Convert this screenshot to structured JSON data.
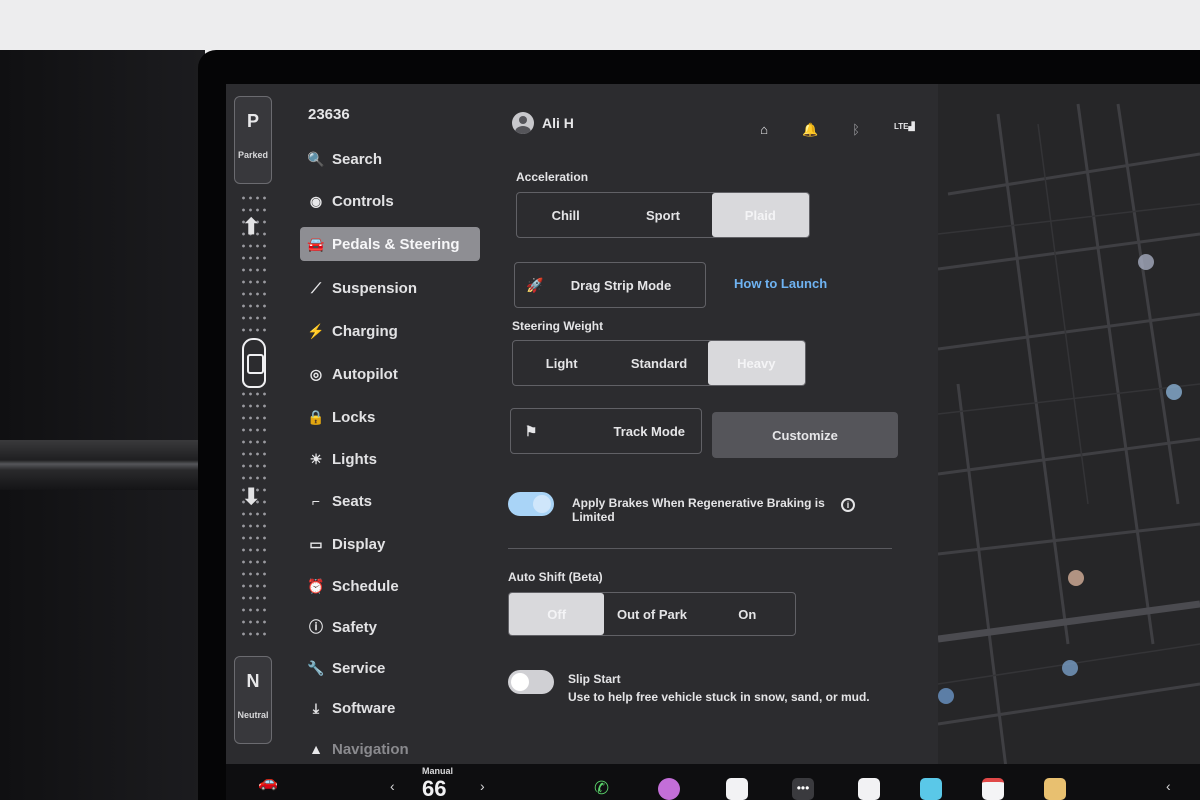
{
  "gear": {
    "top_letter": "P",
    "top_label": "Parked",
    "bottom_letter": "N",
    "bottom_label": "Neutral"
  },
  "odometer": "23636",
  "menu": [
    {
      "icon": "search-icon",
      "glyph": "🔍",
      "label": "Search",
      "active": false
    },
    {
      "icon": "controls-icon",
      "glyph": "◉",
      "label": "Controls",
      "active": false
    },
    {
      "icon": "car-icon",
      "glyph": "🚘",
      "label": "Pedals & Steering",
      "active": true
    },
    {
      "icon": "suspension-icon",
      "glyph": "⟋",
      "label": "Suspension",
      "active": false
    },
    {
      "icon": "lightning-icon",
      "glyph": "⚡",
      "label": "Charging",
      "active": false
    },
    {
      "icon": "steering-wheel-icon",
      "glyph": "◎",
      "label": "Autopilot",
      "active": false
    },
    {
      "icon": "lock-icon",
      "glyph": "🔒",
      "label": "Locks",
      "active": false
    },
    {
      "icon": "sun-icon",
      "glyph": "☀",
      "label": "Lights",
      "active": false
    },
    {
      "icon": "seat-icon",
      "glyph": "⌐",
      "label": "Seats",
      "active": false
    },
    {
      "icon": "display-icon",
      "glyph": "▭",
      "label": "Display",
      "active": false
    },
    {
      "icon": "alarm-clock-icon",
      "glyph": "⏰",
      "label": "Schedule",
      "active": false
    },
    {
      "icon": "info-circle-icon",
      "glyph": "ⓘ",
      "label": "Safety",
      "active": false
    },
    {
      "icon": "wrench-icon",
      "glyph": "🔧",
      "label": "Service",
      "active": false
    },
    {
      "icon": "download-icon",
      "glyph": "⤓",
      "label": "Software",
      "active": false
    },
    {
      "icon": "navigation-icon",
      "glyph": "▲",
      "label": "Navigation",
      "active": false
    }
  ],
  "profile": {
    "name": "Ali H"
  },
  "status": {
    "icons": [
      "garage-icon",
      "bell-icon",
      "bluetooth-icon",
      "lte-signal-icon"
    ],
    "lte_label": "LTE"
  },
  "acceleration": {
    "label": "Acceleration",
    "options": [
      "Chill",
      "Sport",
      "Plaid"
    ],
    "selected": "Plaid"
  },
  "drag_strip": {
    "label": "Drag Strip Mode",
    "link": "How to Launch"
  },
  "steering_weight": {
    "label": "Steering Weight",
    "options": [
      "Light",
      "Standard",
      "Heavy"
    ],
    "selected": "Heavy"
  },
  "track_mode": {
    "label": "Track Mode",
    "customize": "Customize"
  },
  "regen_brakes": {
    "label": "Apply Brakes When Regenerative Braking is Limited",
    "enabled": true
  },
  "auto_shift": {
    "label": "Auto Shift (Beta)",
    "options": [
      "Off",
      "Out of Park",
      "On"
    ],
    "selected": "Off"
  },
  "slip_start": {
    "label": "Slip Start",
    "description": "Use to help free vehicle stuck in snow, sand, or mud.",
    "enabled": false
  },
  "taskbar": {
    "temp_mode": "Manual",
    "temp_value": "66"
  }
}
